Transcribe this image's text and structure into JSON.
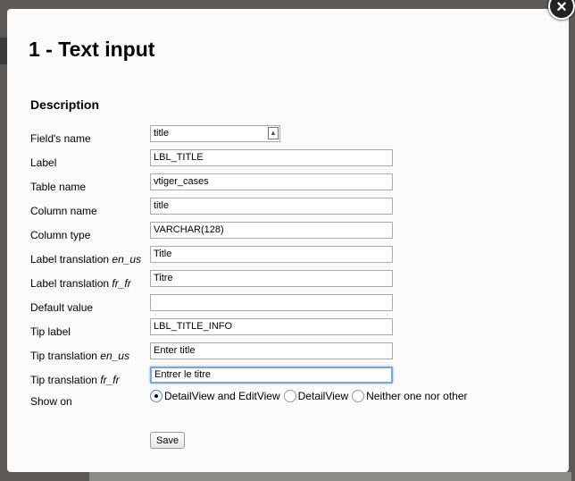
{
  "title": "1 - Text input",
  "section": "Description",
  "close_icon": "close-icon",
  "fields": [
    {
      "label": "Field's name",
      "suffix": "",
      "value": "title"
    },
    {
      "label": "Label",
      "suffix": "",
      "value": "LBL_TITLE"
    },
    {
      "label": "Table name",
      "suffix": "",
      "value": "vtiger_cases"
    },
    {
      "label": "Column name",
      "suffix": "",
      "value": "title"
    },
    {
      "label": "Column type",
      "suffix": "",
      "value": "VARCHAR(128)"
    },
    {
      "label": "Label translation ",
      "suffix": "en_us",
      "value": "Title"
    },
    {
      "label": "Label translation ",
      "suffix": "fr_fr",
      "value": "Titre"
    },
    {
      "label": "Default value",
      "suffix": "",
      "value": ""
    },
    {
      "label": "Tip label",
      "suffix": "",
      "value": "LBL_TITLE_INFO"
    },
    {
      "label": "Tip translation ",
      "suffix": "en_us",
      "value": "Enter title"
    },
    {
      "label": "Tip translation ",
      "suffix": "fr_fr",
      "value": "Entrer le titre"
    }
  ],
  "show_on": {
    "label": "Show on",
    "options": [
      "DetailView and EditView",
      "DetailView",
      "Neither one nor other"
    ],
    "selected": 0
  },
  "save_label": "Save"
}
